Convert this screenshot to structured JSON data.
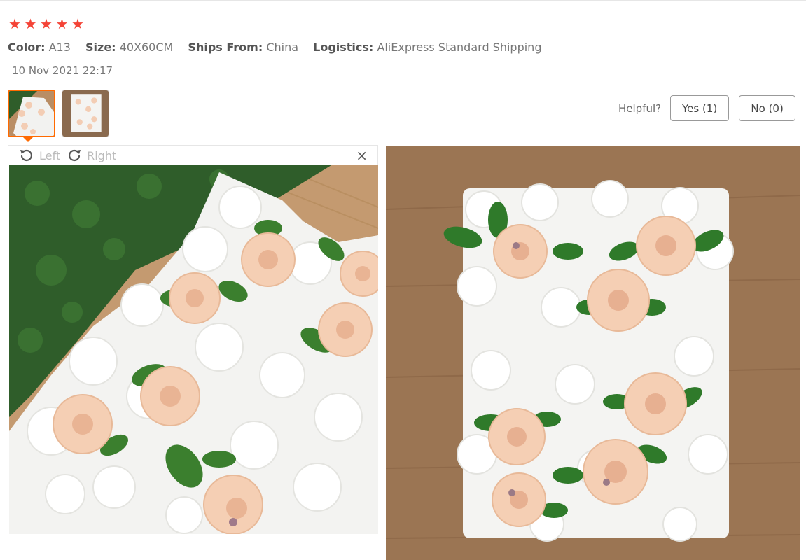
{
  "review": {
    "rating": 5,
    "attributes": [
      {
        "key": "Color:",
        "value": "A13"
      },
      {
        "key": "Size:",
        "value": "40X60CM"
      },
      {
        "key": "Ships From:",
        "value": "China"
      },
      {
        "key": "Logistics:",
        "value": "AliExpress Standard Shipping"
      }
    ],
    "date": "10 Nov 2021 22:17"
  },
  "helpful": {
    "label": "Helpful?",
    "yes_label": "Yes (1)",
    "no_label": "No (0)"
  },
  "viewer": {
    "rotate_left_label": "Left",
    "rotate_right_label": "Right",
    "close_glyph": "×",
    "icons": [
      "rotate-left-icon",
      "rotate-right-icon",
      "close-icon"
    ]
  },
  "colors": {
    "star": "#f44336",
    "thumb_selected_border": "#ff6a00",
    "wood": "#b98d64",
    "hedge": "#2f5d2a",
    "rose": "#f3cdb4",
    "leaf": "#3a7d2c"
  }
}
